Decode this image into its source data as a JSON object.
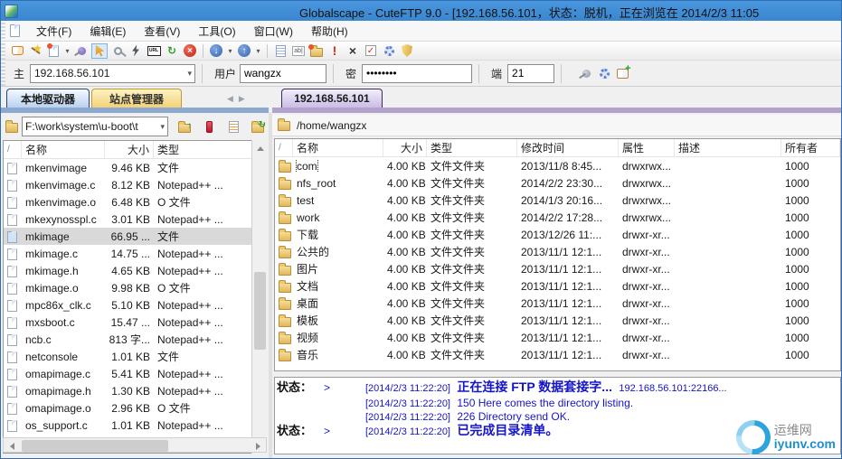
{
  "window": {
    "title": "Globalscape - CuteFTP 9.0 - [192.168.56.101，状态：脱机，正在浏览在 2014/2/3 11:05"
  },
  "menu": {
    "items": [
      {
        "label": "文件(F)"
      },
      {
        "label": "编辑(E)"
      },
      {
        "label": "查看(V)"
      },
      {
        "label": "工具(O)"
      },
      {
        "label": "窗口(W)"
      },
      {
        "label": "帮助(H)"
      }
    ]
  },
  "toolbar": {
    "url_label": "URL",
    "icons": [
      "site-manager",
      "connection-wizard",
      "new-document",
      "new-document-dropdown",
      "quick-connect",
      "pointer-select",
      "reconnect",
      "disconnect",
      "url",
      "refresh",
      "stop",
      "download",
      "download-dropdown",
      "upload",
      "upload-dropdown",
      "transfer-queue",
      "rename",
      "new-folder",
      "priority",
      "delete",
      "verify",
      "settings-gear",
      "security-shield"
    ]
  },
  "quickconnect": {
    "host_label": "主",
    "host": "192.168.56.101",
    "user_label": "用户",
    "user": "wangzx",
    "password_label": "密",
    "password_masked": "••••••••",
    "port_label": "端",
    "port": "21",
    "icons": [
      "connect-plug",
      "settings-gear",
      "add-site-book"
    ]
  },
  "tabs": {
    "local_active": "本地驱动器",
    "site_manager": "站点管理器",
    "remote_active": "192.168.56.101"
  },
  "local_panel": {
    "path": "F:\\work\\system\\u-boot\\t",
    "sort_glyph": "/",
    "columns": [
      "名称",
      "大小",
      "类型"
    ],
    "toolbar_icons": [
      "up-directory",
      "bookmark",
      "view-document",
      "refresh-folder"
    ],
    "files": [
      {
        "name": "mkenvimage",
        "size": "9.46 KB",
        "type": "文件"
      },
      {
        "name": "mkenvimage.c",
        "size": "8.12 KB",
        "type": "Notepad++ ..."
      },
      {
        "name": "mkenvimage.o",
        "size": "6.48 KB",
        "type": "O 文件"
      },
      {
        "name": "mkexynosspl.c",
        "size": "3.01 KB",
        "type": "Notepad++ ..."
      },
      {
        "name": "mkimage",
        "size": "66.95 ...",
        "type": "文件",
        "selected": true
      },
      {
        "name": "mkimage.c",
        "size": "14.75 ...",
        "type": "Notepad++ ..."
      },
      {
        "name": "mkimage.h",
        "size": "4.65 KB",
        "type": "Notepad++ ..."
      },
      {
        "name": "mkimage.o",
        "size": "9.98 KB",
        "type": "O 文件"
      },
      {
        "name": "mpc86x_clk.c",
        "size": "5.10 KB",
        "type": "Notepad++ ..."
      },
      {
        "name": "mxsboot.c",
        "size": "15.47 ...",
        "type": "Notepad++ ..."
      },
      {
        "name": "ncb.c",
        "size": "813 字...",
        "type": "Notepad++ ..."
      },
      {
        "name": "netconsole",
        "size": "1.01 KB",
        "type": "文件"
      },
      {
        "name": "omapimage.c",
        "size": "5.41 KB",
        "type": "Notepad++ ..."
      },
      {
        "name": "omapimage.h",
        "size": "1.30 KB",
        "type": "Notepad++ ..."
      },
      {
        "name": "omapimage.o",
        "size": "2.96 KB",
        "type": "O 文件"
      },
      {
        "name": "os_support.c",
        "size": "1.01 KB",
        "type": "Notepad++ ..."
      }
    ]
  },
  "remote_panel": {
    "path": "/home/wangzx",
    "sort_glyph": "/",
    "columns": [
      "名称",
      "大小",
      "类型",
      "修改时间",
      "属性",
      "描述",
      "所有者"
    ],
    "files": [
      {
        "name": "com",
        "size": "4.00 KB",
        "type": "文件文件夹",
        "modified": "2013/11/8 8:45...",
        "attrs": "drwxrwx...",
        "desc": "",
        "owner": "1000",
        "focused": true
      },
      {
        "name": "nfs_root",
        "size": "4.00 KB",
        "type": "文件文件夹",
        "modified": "2014/2/2 23:30...",
        "attrs": "drwxrwx...",
        "desc": "",
        "owner": "1000"
      },
      {
        "name": "test",
        "size": "4.00 KB",
        "type": "文件文件夹",
        "modified": "2014/1/3 20:16...",
        "attrs": "drwxrwx...",
        "desc": "",
        "owner": "1000"
      },
      {
        "name": "work",
        "size": "4.00 KB",
        "type": "文件文件夹",
        "modified": "2014/2/2 17:28...",
        "attrs": "drwxrwx...",
        "desc": "",
        "owner": "1000"
      },
      {
        "name": "下载",
        "size": "4.00 KB",
        "type": "文件文件夹",
        "modified": "2013/12/26 11:...",
        "attrs": "drwxr-xr...",
        "desc": "",
        "owner": "1000"
      },
      {
        "name": "公共的",
        "size": "4.00 KB",
        "type": "文件文件夹",
        "modified": "2013/11/1 12:1...",
        "attrs": "drwxr-xr...",
        "desc": "",
        "owner": "1000"
      },
      {
        "name": "图片",
        "size": "4.00 KB",
        "type": "文件文件夹",
        "modified": "2013/11/1 12:1...",
        "attrs": "drwxr-xr...",
        "desc": "",
        "owner": "1000"
      },
      {
        "name": "文档",
        "size": "4.00 KB",
        "type": "文件文件夹",
        "modified": "2013/11/1 12:1...",
        "attrs": "drwxr-xr...",
        "desc": "",
        "owner": "1000"
      },
      {
        "name": "桌面",
        "size": "4.00 KB",
        "type": "文件文件夹",
        "modified": "2013/11/1 12:1...",
        "attrs": "drwxr-xr...",
        "desc": "",
        "owner": "1000"
      },
      {
        "name": "模板",
        "size": "4.00 KB",
        "type": "文件文件夹",
        "modified": "2013/11/1 12:1...",
        "attrs": "drwxr-xr...",
        "desc": "",
        "owner": "1000"
      },
      {
        "name": "视频",
        "size": "4.00 KB",
        "type": "文件文件夹",
        "modified": "2013/11/1 12:1...",
        "attrs": "drwxr-xr...",
        "desc": "",
        "owner": "1000"
      },
      {
        "name": "音乐",
        "size": "4.00 KB",
        "type": "文件文件夹",
        "modified": "2013/11/1 12:1...",
        "attrs": "drwxr-xr...",
        "desc": "",
        "owner": "1000"
      }
    ]
  },
  "log": {
    "lines": [
      {
        "label": "状态：",
        "arrow": ">",
        "time": "[2014/2/3 11:22:20]",
        "message": "正在连接 FTP 数据套接字...",
        "suffix": "192.168.56.101:22166...",
        "bold": true
      },
      {
        "time": "[2014/2/3 11:22:20]",
        "message": "150 Here comes the directory listing."
      },
      {
        "time": "[2014/2/3 11:22:20]",
        "message": "226 Directory send OK."
      },
      {
        "label": "状态：",
        "arrow": ">",
        "time": "[2014/2/3 11:22:20]",
        "message": "已完成目录清单。",
        "bold": true
      }
    ]
  },
  "watermark": {
    "site": "运维网",
    "domain": "iyunv.com"
  },
  "colors": {
    "titlebar": "#3e8cd7",
    "local_strip": "#8ea9cf",
    "remote_strip": "#b3a2cb",
    "active_tab": "#b9d2ef",
    "site_manager_tab": "#f3d276",
    "remote_tab": "#cbbce6",
    "log_text": "#1414cc",
    "selection": "#d9d9d9",
    "folder": "#e3b65a"
  }
}
